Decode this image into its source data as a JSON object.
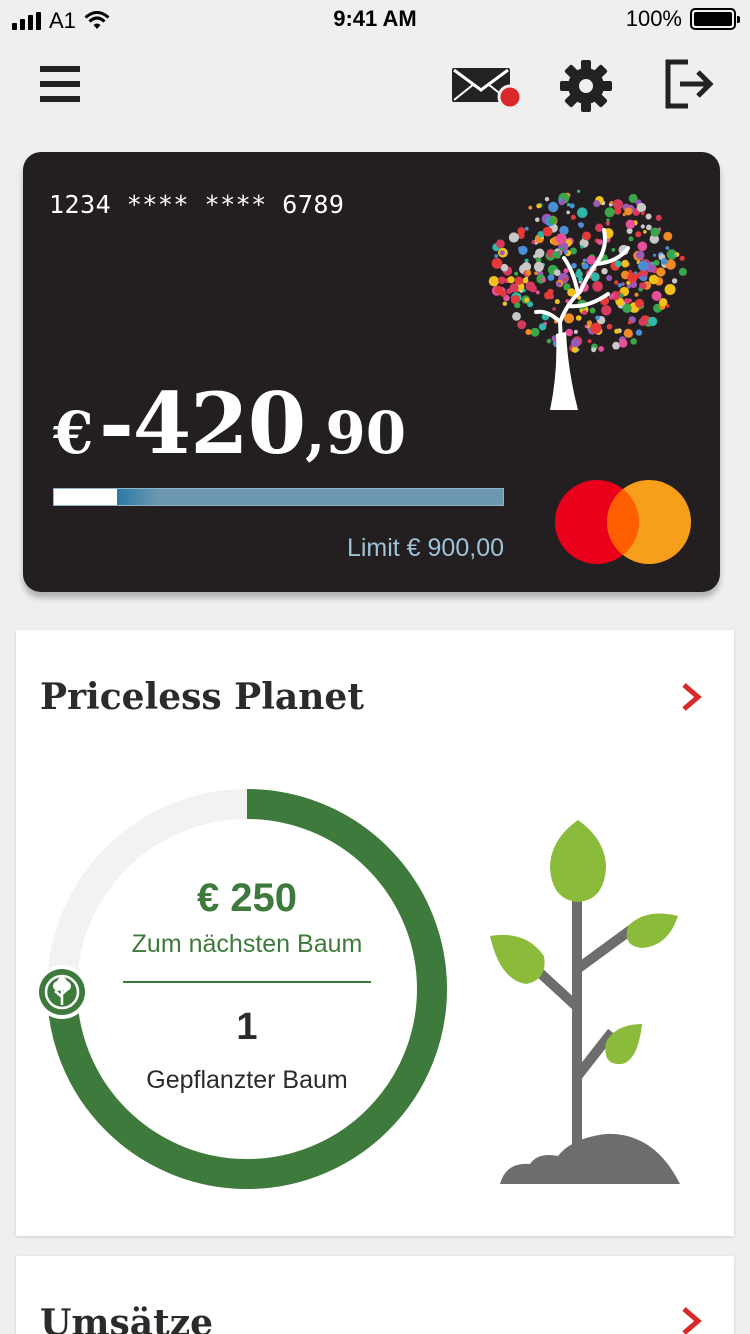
{
  "status_bar": {
    "carrier": "A1",
    "time": "9:41 AM",
    "battery": "100%",
    "battery_level": 1.0
  },
  "nav": {
    "icons": [
      "menu-icon",
      "mail-icon",
      "gear-icon",
      "logout-icon"
    ],
    "has_unread_mail": true
  },
  "card": {
    "number": "1234 **** **** 6789",
    "balance_currency": "€",
    "balance_main": "-420",
    "balance_decimal": ",90",
    "limit_text": "Limit € 900,00",
    "limit_used_fraction": 0.14,
    "brand": "mastercard"
  },
  "planet": {
    "title": "Priceless Planet",
    "amount": "€ 250",
    "amount_label": "Zum nächsten Baum",
    "trees_count": "1",
    "trees_label": "Gepflanzter Baum",
    "progress_fraction": 0.75
  },
  "transactions": {
    "title": "Umsätze"
  },
  "colors": {
    "background": "#efefef",
    "card_bg": "#231f20",
    "accent_green": "#3e7a3c",
    "leaf_green": "#8bbb3a",
    "chevron_red": "#d8282a",
    "mc_red": "#eb001b",
    "mc_orange": "#f79e1b",
    "limit_blue": "#6b97b0"
  }
}
